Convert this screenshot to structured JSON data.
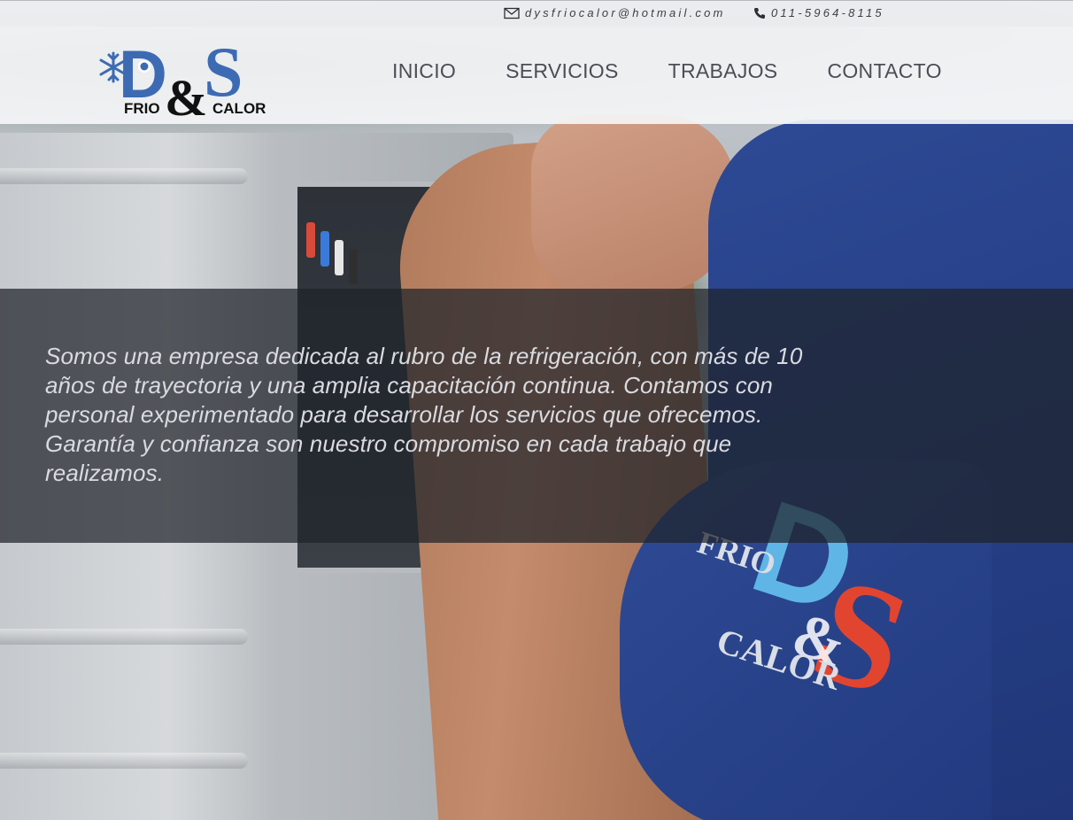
{
  "topbar": {
    "email": "dysfriocalor@hotmail.com",
    "phone": "011-5964-8115",
    "email_icon": "envelope-icon",
    "phone_icon": "phone-icon"
  },
  "logo": {
    "letters": "D&S",
    "left_word": "FRIO",
    "right_word": "CALOR",
    "icons": [
      "snowflake-icon",
      "sun-icon"
    ],
    "colors": {
      "primary": "#3d6bb3",
      "ampersand": "#111111"
    }
  },
  "nav": {
    "items": [
      {
        "label": "INICIO"
      },
      {
        "label": "SERVICIOS"
      },
      {
        "label": "TRABAJOS"
      },
      {
        "label": "CONTACTO"
      }
    ]
  },
  "hero": {
    "text": "Somos una empresa dedicada al rubro de la refrigeración, con más de 10 años de trayectoria y una amplia capacitación continua. Contamos con personal experimentado para desarrollar los servicios que ofrecemos. Garantía y confianza son nuestro compromiso en cada trabajo que realizamos.",
    "shirt_logo": {
      "letters": "D&S",
      "left_word": "FRIO",
      "right_word": "CALOR",
      "colors": {
        "d": "#5fb6e6",
        "s": "#e2452f"
      }
    }
  }
}
